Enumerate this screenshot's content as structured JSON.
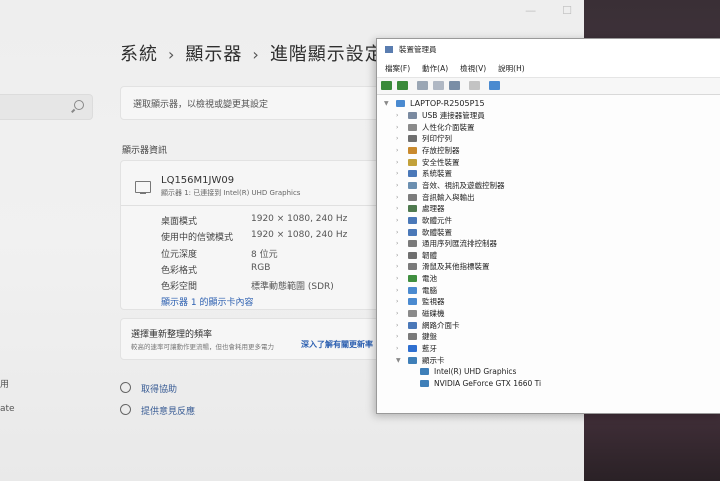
{
  "settings": {
    "breadcrumb": [
      "系統",
      "顯示器",
      "進階顯示設定"
    ],
    "select_display_hint": "選取顯示器，以檢視或變更其設定",
    "section_display_info": "顯示器資訊",
    "monitor": {
      "name": "LQ156M1JW09",
      "subtitle": "顯示器 1: 已連接到 Intel(R) UHD Graphics",
      "rows": [
        {
          "key": "桌面模式",
          "value": "1920 × 1080, 240 Hz"
        },
        {
          "key": "使用中的信號模式",
          "value": "1920 × 1080, 240 Hz"
        },
        {
          "key": "位元深度",
          "value": "8 位元"
        },
        {
          "key": "色彩格式",
          "value": "RGB"
        },
        {
          "key": "色彩空間",
          "value": "標準動態範圍 (SDR)"
        }
      ],
      "adapter_link": "顯示器 1 的顯示卡內容"
    },
    "refresh": {
      "title": "選擇重新整理的頻率",
      "subtitle": "較高的速率可讓動作更流暢，但也會耗用更多電力",
      "link": "深入了解有關更新率"
    },
    "help_links": [
      "取得協助",
      "提供意見反應"
    ],
    "sidebar_fragments": [
      "用",
      "ate"
    ]
  },
  "device_manager": {
    "title": "裝置管理員",
    "menu": [
      "檔案(F)",
      "動作(A)",
      "檢視(V)",
      "說明(H)"
    ],
    "root": "LAPTOP-R2505P15",
    "categories": [
      {
        "label": "USB 連接器管理員",
        "icon": "usb-icon",
        "color": "#7a8aa0"
      },
      {
        "label": "人性化介面裝置",
        "icon": "hid-icon",
        "color": "#8a8a8a"
      },
      {
        "label": "列印佇列",
        "icon": "printer-icon",
        "color": "#6f6f6f"
      },
      {
        "label": "存放控制器",
        "icon": "storage-icon",
        "color": "#c98a2e"
      },
      {
        "label": "安全性裝置",
        "icon": "security-icon",
        "color": "#c2a13a"
      },
      {
        "label": "系統裝置",
        "icon": "system-icon",
        "color": "#4a78b8"
      },
      {
        "label": "音效、視訊及遊戲控制器",
        "icon": "audio-icon",
        "color": "#6b8fb0"
      },
      {
        "label": "音訊輸入與輸出",
        "icon": "speaker-icon",
        "color": "#7c7c7c"
      },
      {
        "label": "處理器",
        "icon": "cpu-icon",
        "color": "#4f7a4f"
      },
      {
        "label": "軟體元件",
        "icon": "software-component-icon",
        "color": "#4a78b8"
      },
      {
        "label": "軟體裝置",
        "icon": "software-device-icon",
        "color": "#4a78b8"
      },
      {
        "label": "通用序列匯流排控制器",
        "icon": "usb-controller-icon",
        "color": "#7a7a7a"
      },
      {
        "label": "韌體",
        "icon": "firmware-icon",
        "color": "#6f6f6f"
      },
      {
        "label": "滑鼠及其他指標裝置",
        "icon": "mouse-icon",
        "color": "#7a7a7a"
      },
      {
        "label": "電池",
        "icon": "battery-icon",
        "color": "#3f8f3f"
      },
      {
        "label": "電腦",
        "icon": "computer-icon",
        "color": "#4a8ad0"
      },
      {
        "label": "監視器",
        "icon": "monitor-icon",
        "color": "#4a8ad0"
      },
      {
        "label": "磁碟機",
        "icon": "disk-icon",
        "color": "#8a8a8a"
      },
      {
        "label": "網路介面卡",
        "icon": "network-icon",
        "color": "#4a78b8"
      },
      {
        "label": "鍵盤",
        "icon": "keyboard-icon",
        "color": "#7a7a7a"
      },
      {
        "label": "藍牙",
        "icon": "bluetooth-icon",
        "color": "#2f6fd0"
      },
      {
        "label": "顯示卡",
        "icon": "display-adapter-icon",
        "color": "#3f7fb8"
      }
    ],
    "display_adapters": [
      "Intel(R) UHD Graphics",
      "NVIDIA GeForce GTX 1660 Ti"
    ]
  }
}
